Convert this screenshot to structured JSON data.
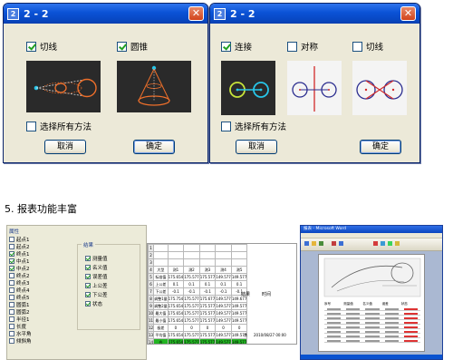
{
  "dialog1": {
    "title": "2 - 2",
    "options": [
      {
        "label": "切线",
        "checked": true
      },
      {
        "label": "圆锥",
        "checked": true
      }
    ],
    "select_all": {
      "label": "选择所有方法",
      "checked": false
    },
    "cancel_label": "取消",
    "ok_label": "确定"
  },
  "dialog2": {
    "title": "2 - 2",
    "options": [
      {
        "label": "连接",
        "checked": true
      },
      {
        "label": "对称",
        "checked": false
      },
      {
        "label": "切线",
        "checked": false
      }
    ],
    "select_all": {
      "label": "选择所有方法",
      "checked": false
    },
    "cancel_label": "取消",
    "ok_label": "确定"
  },
  "section_heading": "5. 报表功能丰富",
  "panel": {
    "tree_header": "属性",
    "tree_items": [
      {
        "label": "起点1",
        "checked": false
      },
      {
        "label": "起点2",
        "checked": false
      },
      {
        "label": "终点1",
        "checked": true
      },
      {
        "label": "中点1",
        "checked": true
      },
      {
        "label": "中点2",
        "checked": true
      },
      {
        "label": "终点2",
        "checked": false
      },
      {
        "label": "终点3",
        "checked": false
      },
      {
        "label": "终点4",
        "checked": false
      },
      {
        "label": "终点5",
        "checked": false
      },
      {
        "label": "圆弧1",
        "checked": false
      },
      {
        "label": "圆弧2",
        "checked": false
      },
      {
        "label": "半径1",
        "checked": false
      },
      {
        "label": "长度",
        "checked": false
      },
      {
        "label": "水平角",
        "checked": false
      },
      {
        "label": "倾斜角",
        "checked": false
      }
    ],
    "group_label": "结果",
    "group_items": [
      {
        "label": "测量值",
        "checked": true
      },
      {
        "label": "名义值",
        "checked": true
      },
      {
        "label": "误差值",
        "checked": true
      },
      {
        "label": "上公差",
        "checked": true
      },
      {
        "label": "下公差",
        "checked": true
      },
      {
        "label": "状态",
        "checked": true
      }
    ]
  },
  "sheet": {
    "header": [
      "",
      "",
      "",
      "",
      "",
      ""
    ],
    "rows": [
      [
        "",
        "",
        "",
        "",
        "",
        ""
      ],
      [
        "",
        "",
        "",
        "",
        "",
        ""
      ],
      [
        "",
        "",
        "",
        "",
        "",
        ""
      ],
      [
        "大型",
        "测1",
        "测2",
        "测3",
        "测4",
        "测5"
      ],
      [
        "标准值",
        "175.654",
        "175.577",
        "175.577",
        "149.577",
        "149.577"
      ],
      [
        "上公差",
        "0.1",
        "0.1",
        "0.1",
        "0.1",
        "0.1"
      ],
      [
        "下公差",
        "-0.1",
        "-0.1",
        "-0.1",
        "-0.1",
        "-0.1"
      ],
      [
        "调整1量",
        "175.754",
        "175.577",
        "175.677",
        "149.577",
        "149.677"
      ],
      [
        "调整2量",
        "175.654",
        "175.577",
        "175.577",
        "149.577",
        "149.577"
      ],
      [
        "最大值",
        "175.654",
        "175.577",
        "175.577",
        "149.577",
        "149.577"
      ],
      [
        "最小值",
        "175.654",
        "175.577",
        "175.577",
        "149.577",
        "149.577"
      ],
      [
        "极差",
        "0",
        "0",
        "0",
        "0",
        "0"
      ],
      [
        "平均值",
        "175.654",
        "175.577",
        "175.577",
        "149.577",
        "149.577"
      ],
      [
        "合",
        "175.654",
        "175.577",
        "175.577",
        "149.577",
        "149.577"
      ]
    ],
    "side_labels": [
      "结果",
      "时间"
    ],
    "date_cell": "2010/08/27 00:00",
    "status_cell": "合"
  },
  "word": {
    "title": "报表 - Microsoft Word",
    "table_cols": [
      "序号",
      "测量值",
      "名义值",
      "误差",
      "状态"
    ]
  },
  "colors": {
    "accent_green": "#22b422",
    "titlebar_blue": "#0a52d6",
    "curve_orange": "#ee6f2a",
    "curve_navy": "#2b2d8f",
    "curve_red": "#d32a2a",
    "curve_cyan": "#27c6e9"
  }
}
